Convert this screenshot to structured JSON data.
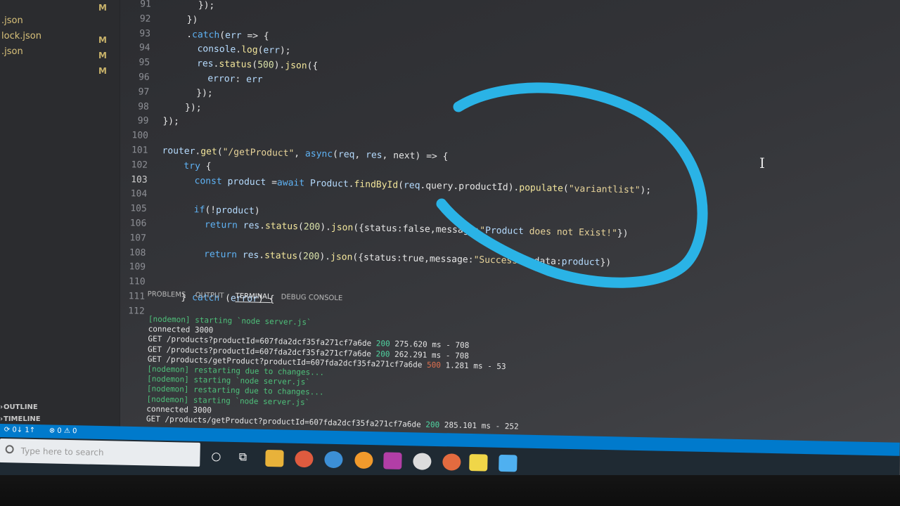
{
  "explorer": {
    "files": [
      {
        "name": ".json",
        "badge": "M"
      },
      {
        "name": "lock.json",
        "badge": "M"
      },
      {
        "name": ".json",
        "badge": "M"
      },
      {
        "name": "",
        "badge": "M"
      }
    ],
    "outline_label": "OUTLINE",
    "timeline_label": "TIMELINE"
  },
  "editor": {
    "line_numbers": [
      "91",
      "92",
      "93",
      "94",
      "95",
      "96",
      "97",
      "98",
      "99",
      "100",
      "101",
      "102",
      "103",
      "104",
      "105",
      "106",
      "107",
      "108",
      "109",
      "110",
      "111",
      "112"
    ],
    "active_line": "103",
    "code": [
      "      });",
      "    })",
      "    .catch(err => {",
      "      console.log(err);",
      "      res.status(500).json({",
      "        error: err",
      "      });",
      "    });",
      "});",
      "",
      "router.get(\"/getProduct\", async(req, res, next) => {",
      "    try {",
      "      const product =await Product.findById(req.query.productId).populate(\"variantlist\");",
      "",
      "      if(!product)",
      "        return res.status(200).json({status:false,message:\"Product does not Exist!\"})",
      "",
      "        return res.status(200).json({status:true,message:\"Success\", data:product})",
      "",
      "",
      "    } catch (error) {"
    ]
  },
  "panel": {
    "tabs": [
      "PROBLEMS",
      "OUTPUT",
      "TERMINAL",
      "DEBUG CONSOLE"
    ],
    "active_tab": "TERMINAL",
    "terminal_lines": [
      {
        "text": "[nodemon] starting `node server.js`",
        "kind": "green"
      },
      {
        "text": "connected 3000",
        "kind": "plain"
      },
      {
        "pre": "GET /products?productId=607fda2dcf35fa271cf7a6de ",
        "status": "200",
        "post": " 275.620 ms - 708",
        "kind": "req"
      },
      {
        "pre": "GET /products?productId=607fda2dcf35fa271cf7a6de ",
        "status": "200",
        "post": " 262.291 ms - 708",
        "kind": "req"
      },
      {
        "pre": "GET /products/getProduct?productId=607fda2dcf35fa271cf7a6de ",
        "status": "500",
        "post": " 1.281 ms - 53",
        "kind": "err"
      },
      {
        "text": "[nodemon] restarting due to changes...",
        "kind": "green"
      },
      {
        "text": "[nodemon] starting `node server.js`",
        "kind": "green"
      },
      {
        "text": "[nodemon] restarting due to changes...",
        "kind": "green"
      },
      {
        "text": "[nodemon] starting `node server.js`",
        "kind": "green"
      },
      {
        "text": "connected 3000",
        "kind": "plain"
      },
      {
        "pre": "GET /products/getProduct?productId=607fda2dcf35fa271cf7a6de ",
        "status": "200",
        "post": " 285.101 ms - 252",
        "kind": "req"
      }
    ]
  },
  "statusbar": {
    "errors": "⊗ 0 ⚠ 0",
    "sync": "⟳ 0↓ 1↑"
  },
  "taskbar": {
    "search_placeholder": "Type here to search"
  },
  "colors": {
    "annotation_stroke": "#2ab3e6",
    "status_bar": "#007acc"
  }
}
